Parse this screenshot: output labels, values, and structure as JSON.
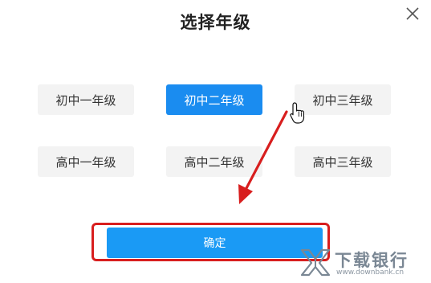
{
  "dialog": {
    "title": "选择年级",
    "close_icon": "close-icon"
  },
  "grades": [
    {
      "label": "初中一年级",
      "selected": false
    },
    {
      "label": "初中二年级",
      "selected": true
    },
    {
      "label": "初中三年级",
      "selected": false
    },
    {
      "label": "高中一年级",
      "selected": false
    },
    {
      "label": "高中二年级",
      "selected": false
    },
    {
      "label": "高中三年级",
      "selected": false
    }
  ],
  "confirm": {
    "label": "确定"
  },
  "annotation": {
    "arrow_color": "#d81e1e",
    "highlight_color": "#d81e1e",
    "cursor_icon": "hand-pointer-icon"
  },
  "watermark": {
    "text": "下载银行",
    "url": "www.downbank.cn",
    "logo_icon": "downbank-logo-icon"
  },
  "colors": {
    "selected_bg": "#1a8cf0",
    "option_bg": "#f3f3f3",
    "confirm_bg": "#1a9af5"
  }
}
